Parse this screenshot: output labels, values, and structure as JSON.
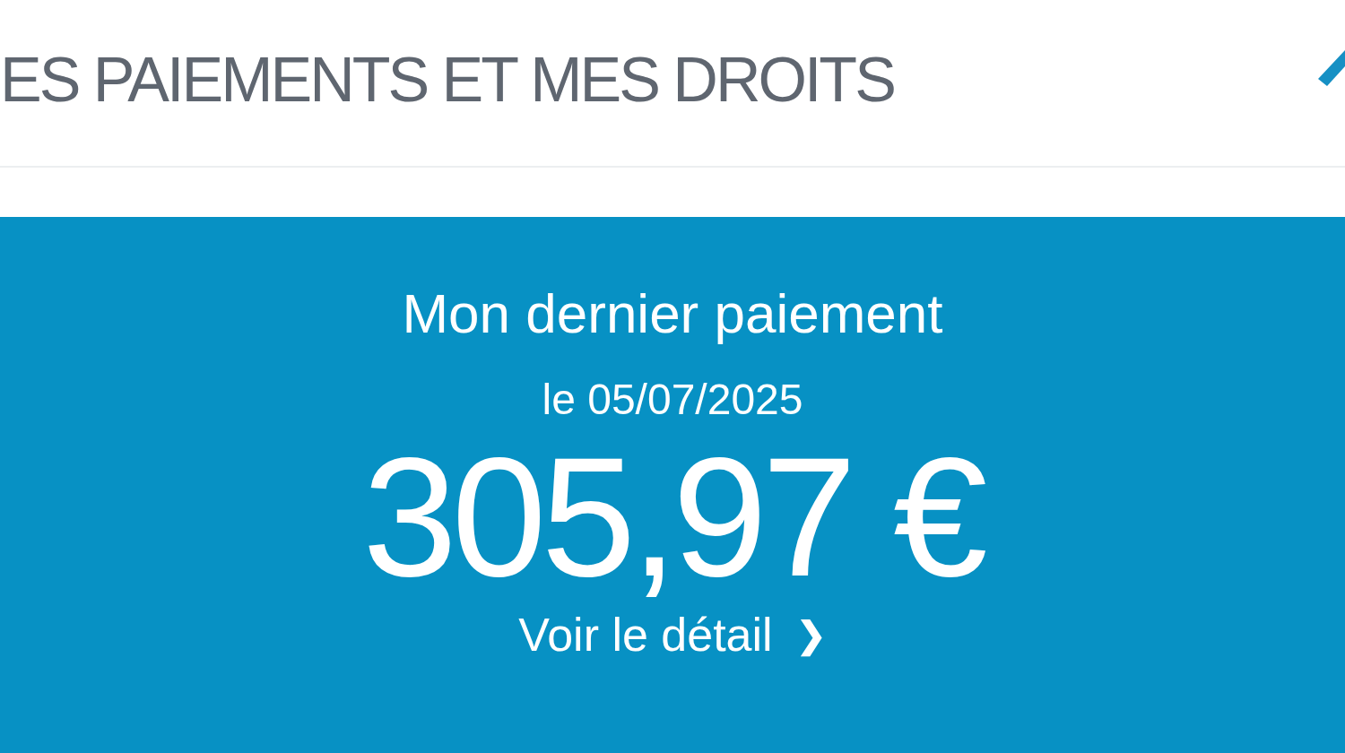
{
  "header": {
    "title": "ES PAIEMENTS ET MES DROITS"
  },
  "payment": {
    "heading": "Mon dernier paiement",
    "date": "le 05/07/2025",
    "amount": "305,97 €",
    "link": "Voir le détail",
    "link_icon": "❯"
  }
}
